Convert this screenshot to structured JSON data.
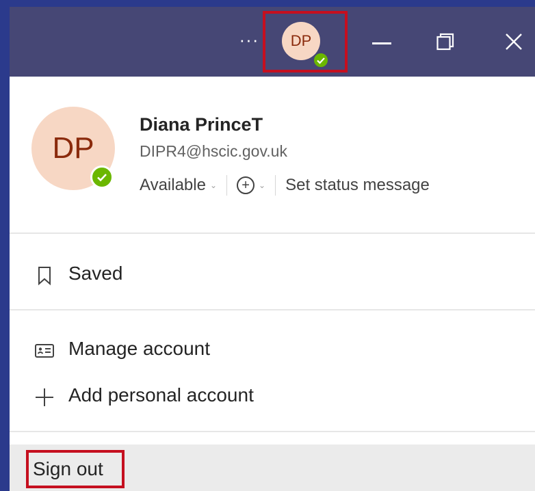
{
  "titlebar": {
    "more_label": "···",
    "avatar_initials": "DP",
    "icons": [
      "more-icon",
      "minimize-icon",
      "restore-icon",
      "close-icon"
    ],
    "bg_color": "#464775",
    "highlight_color": "#c50f1f"
  },
  "profile": {
    "initials": "DP",
    "name": "Diana PrinceT",
    "email": "DIPR4@hscic.gov.uk",
    "availability": "Available",
    "set_status_label": "Set status message",
    "status_color": "#6bb700"
  },
  "menu": {
    "saved_label": "Saved",
    "manage_account_label": "Manage account",
    "add_personal_label": "Add personal account",
    "sign_out_label": "Sign out"
  }
}
